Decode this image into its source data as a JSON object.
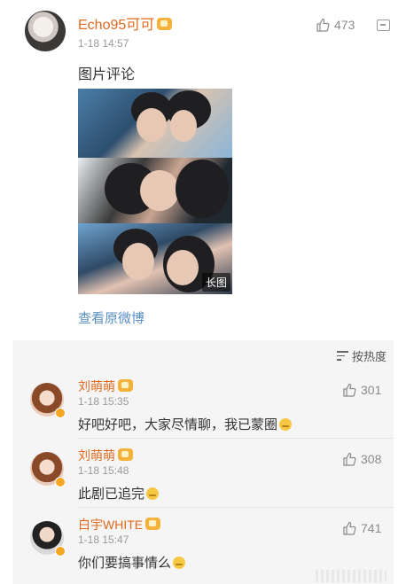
{
  "post": {
    "username": "Echo95可可",
    "time": "1-18 14:57",
    "likes": "473",
    "text": "图片评论",
    "image_badge": "长图",
    "view_original": "查看原微博"
  },
  "comments_section": {
    "sort_label": "按热度",
    "items": [
      {
        "name": "刘萌萌",
        "time": "1-18 15:35",
        "likes": "301",
        "text": "好吧好吧，大家尽情聊，我已蒙圈"
      },
      {
        "name": "刘萌萌",
        "time": "1-18 15:48",
        "likes": "308",
        "text": "此剧已追完"
      },
      {
        "name": "白宇WHITE",
        "time": "1-18 15:47",
        "likes": "741",
        "text": "你们要搞事情么"
      }
    ]
  },
  "colors": {
    "username": "#e06a20",
    "link": "#5a8fc4",
    "badge": "#f5b23b"
  },
  "icons": [
    "thumbs-up-icon",
    "comment-more-icon",
    "sort-icon",
    "vip-badge-icon",
    "verified-badge-icon",
    "emoji-icon"
  ]
}
